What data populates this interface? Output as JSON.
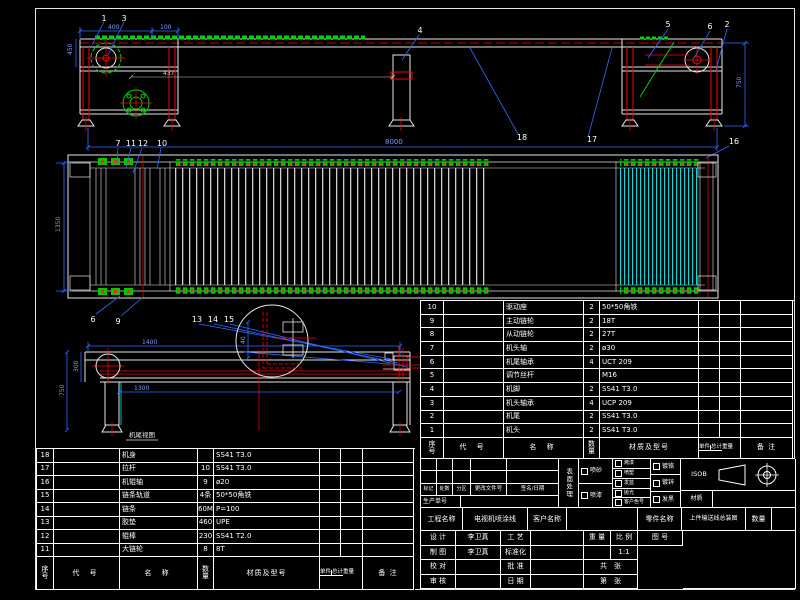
{
  "drawing": {
    "balloons": {
      "n1": "1",
      "n3": "3",
      "n4": "4",
      "n5": "5",
      "n6t": "6",
      "n2": "2",
      "n18": "18",
      "n17": "17",
      "n16": "16",
      "n7": "7",
      "n11": "11",
      "n12": "12",
      "n10": "10",
      "n6b": "6",
      "n9": "9",
      "n13": "13",
      "n14": "14",
      "n15": "15"
    },
    "dims": {
      "total_length": "8000",
      "head_w1": "400",
      "head_w2": "100",
      "head_h": "450",
      "head_span": "437",
      "right_h": "750",
      "plan_w": "1350",
      "tail_w": "1400",
      "tail_span": "1300",
      "tail_h1": "300",
      "tail_h2": "750",
      "detail": "40"
    },
    "labels": {
      "tail_view": "机尾视图"
    }
  },
  "bom_right": {
    "header": {
      "seq1": "序",
      "seq2": "号",
      "code": "代  号",
      "name": "名  称",
      "qty1": "数",
      "qty2": "量",
      "spec": "材质及型号",
      "unit": "单件",
      "total": "总计",
      "weight": "重量",
      "notes": "备 注"
    },
    "rows": [
      {
        "seq": "10",
        "code": "",
        "name": "驱动座",
        "qty": "2",
        "spec": "50*50角铁"
      },
      {
        "seq": "9",
        "code": "",
        "name": "主动链轮",
        "qty": "2",
        "spec": "18T"
      },
      {
        "seq": "8",
        "code": "",
        "name": "从动链轮",
        "qty": "2",
        "spec": "27T"
      },
      {
        "seq": "7",
        "code": "",
        "name": "机头轴",
        "qty": "2",
        "spec": "ø30"
      },
      {
        "seq": "6",
        "code": "",
        "name": "机尾轴承",
        "qty": "4",
        "spec": "UCT 209"
      },
      {
        "seq": "5",
        "code": "",
        "name": "调节丝杆",
        "qty": "",
        "spec": "M16"
      },
      {
        "seq": "4",
        "code": "",
        "name": "机脚",
        "qty": "2",
        "spec": "SS41  T3.0"
      },
      {
        "seq": "3",
        "code": "",
        "name": "机头轴承",
        "qty": "4",
        "spec": "UCP 209"
      },
      {
        "seq": "2",
        "code": "",
        "name": "机尾",
        "qty": "2",
        "spec": "SS41  T3.0"
      },
      {
        "seq": "1",
        "code": "",
        "name": "机头",
        "qty": "2",
        "spec": "SS41  T3.0"
      }
    ]
  },
  "bom_left": {
    "header": {
      "seq1": "序",
      "seq2": "号",
      "code": "代  号",
      "name": "名  称",
      "qty1": "数",
      "qty2": "量",
      "spec": "材质及型号",
      "unit": "单件",
      "total": "总计",
      "weight": "重量",
      "notes": "备 注"
    },
    "rows": [
      {
        "seq": "18",
        "code": "",
        "name": "机身",
        "qty": "",
        "spec": "SS41  T3.0"
      },
      {
        "seq": "17",
        "code": "",
        "name": "拉杆",
        "qty": "10",
        "spec": "SS41  T3.0"
      },
      {
        "seq": "16",
        "code": "",
        "name": "机辊轴",
        "qty": "9",
        "spec": "ø20"
      },
      {
        "seq": "15",
        "code": "",
        "name": "链条轨道",
        "qty": "4条",
        "spec": "50*50角铁"
      },
      {
        "seq": "14",
        "code": "",
        "name": "链条",
        "qty": "60M",
        "spec": "P=100"
      },
      {
        "seq": "13",
        "code": "",
        "name": "胶垫",
        "qty": "460",
        "spec": "UPE"
      },
      {
        "seq": "12",
        "code": "",
        "name": "辊棒",
        "qty": "230",
        "spec": "SS41  T2.0"
      },
      {
        "seq": "11",
        "code": "",
        "name": "大链轮",
        "qty": "8",
        "spec": "8T"
      }
    ]
  },
  "titleblock": {
    "revision": {
      "mark": "标记",
      "count": "处数",
      "zone": "分区",
      "change_no": "更改文件号",
      "sign_date": "签名/日期",
      "prod_no": "生产单号"
    },
    "surface": {
      "title": "表面处理",
      "a1": "喷砂",
      "a2": "喷漆",
      "b1": "烤漆",
      "b2": "喷塑",
      "b3": "发蓝",
      "b4": "抛光",
      "b5": "客户色号",
      "c1": "镀铬",
      "c2": "镀锌",
      "c3": "发黑",
      "iso1": "ISO",
      "iso2": "B",
      "material": "材质"
    },
    "project": {
      "name_label": "工程名称",
      "name_value": "电视机喷涂线",
      "customer_label": "客户名称",
      "customer_value": "",
      "part_label": "零件名称",
      "part_value": "上件输送线总装图",
      "qty_label": "数量"
    },
    "sign": {
      "design": "设 计",
      "design_name": "李卫真",
      "craft": "工 艺",
      "draft": "制 图",
      "draft_name": "李卫真",
      "standard": "标准化",
      "check": "校 对",
      "approve": "批 准",
      "review": "审 核",
      "date": "日 期",
      "weight": "重 量",
      "scale": "比 例",
      "scale_value": "1:1",
      "drawing_no": "图 号",
      "total_sheets": "共　张",
      "sheet_no": "第　张"
    }
  }
}
